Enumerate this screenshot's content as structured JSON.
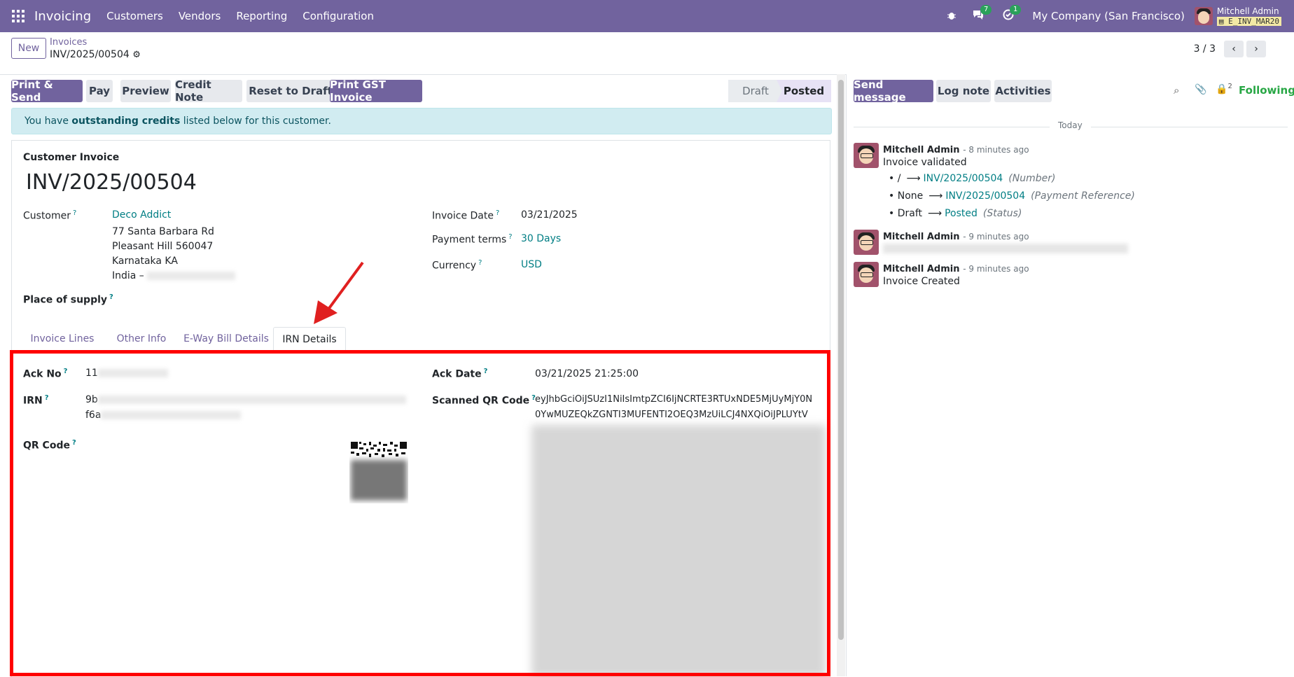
{
  "navbar": {
    "app_name": "Invoicing",
    "menus": [
      "Customers",
      "Vendors",
      "Reporting",
      "Configuration"
    ],
    "bug_icon": "bug-icon",
    "messages_count": "7",
    "activities_count": "1",
    "company": "My Company (San Francisco)",
    "user_name": "Mitchell Admin",
    "db_name": "E_INV_MAR20"
  },
  "control_panel": {
    "new_label": "New",
    "breadcrumb_parent": "Invoices",
    "breadcrumb_current": "INV/2025/00504",
    "pager": "3 / 3"
  },
  "statusbar": {
    "buttons": [
      "Print & Send",
      "Pay",
      "Preview",
      "Credit Note",
      "Reset to Draft",
      "Print GST Invoice"
    ],
    "stages": [
      "Draft",
      "Posted"
    ],
    "active_stage": "Posted"
  },
  "alert": {
    "prefix": "You have ",
    "bold": "outstanding credits",
    "suffix": " listed below for this customer."
  },
  "form": {
    "move_type": "Customer Invoice",
    "name": "INV/2025/00504",
    "customer_label": "Customer",
    "customer_name": "Deco Addict",
    "address_lines": [
      "77 Santa Barbara Rd",
      "Pleasant Hill 560047",
      "Karnataka KA",
      "India – "
    ],
    "place_of_supply_label": "Place of supply",
    "invoice_date_label": "Invoice Date",
    "invoice_date": "03/21/2025",
    "payment_terms_label": "Payment terms",
    "payment_terms": "30 Days",
    "currency_label": "Currency",
    "currency": "USD"
  },
  "tabs": [
    "Invoice Lines",
    "Other Info",
    "E-Way Bill Details",
    "IRN Details"
  ],
  "active_tab": "IRN Details",
  "irn": {
    "ack_no_label": "Ack No",
    "ack_no_visible": "11",
    "irn_label": "IRN",
    "irn_line1_visible": "9b",
    "irn_line2_visible": "f6a",
    "qr_label": "QR Code",
    "ack_date_label": "Ack Date",
    "ack_date": "03/21/2025 21:25:00",
    "scanned_qr_label": "Scanned QR Code",
    "scanned_qr_line1": "eyJhbGciOiJSUzI1NiIsImtpZCI6IjNCRTE3RTUxNDE5MjUyMjY0N",
    "scanned_qr_line2": "0YwMUZEQkZGNTI3MUFENTI2OEQ3MzUiLCJ4NXQiOiJPLUYtV"
  },
  "chatter": {
    "buttons": [
      "Send message",
      "Log note",
      "Activities"
    ],
    "followers_count": "2",
    "following_label": "Following",
    "day_separator": "Today",
    "messages": [
      {
        "author": "Mitchell Admin",
        "time": "- 8 minutes ago",
        "body": "Invoice validated",
        "tracking": [
          {
            "old": "/",
            "new": "INV/2025/00504",
            "field": "(Number)"
          },
          {
            "old": "None",
            "new": "INV/2025/00504",
            "field": "(Payment Reference)"
          },
          {
            "old": "Draft",
            "new": "Posted",
            "field": "(Status)"
          }
        ]
      },
      {
        "author": "Mitchell Admin",
        "time": "- 9 minutes ago",
        "body": ""
      },
      {
        "author": "Mitchell Admin",
        "time": "- 9 minutes ago",
        "body": "Invoice Created"
      }
    ]
  }
}
